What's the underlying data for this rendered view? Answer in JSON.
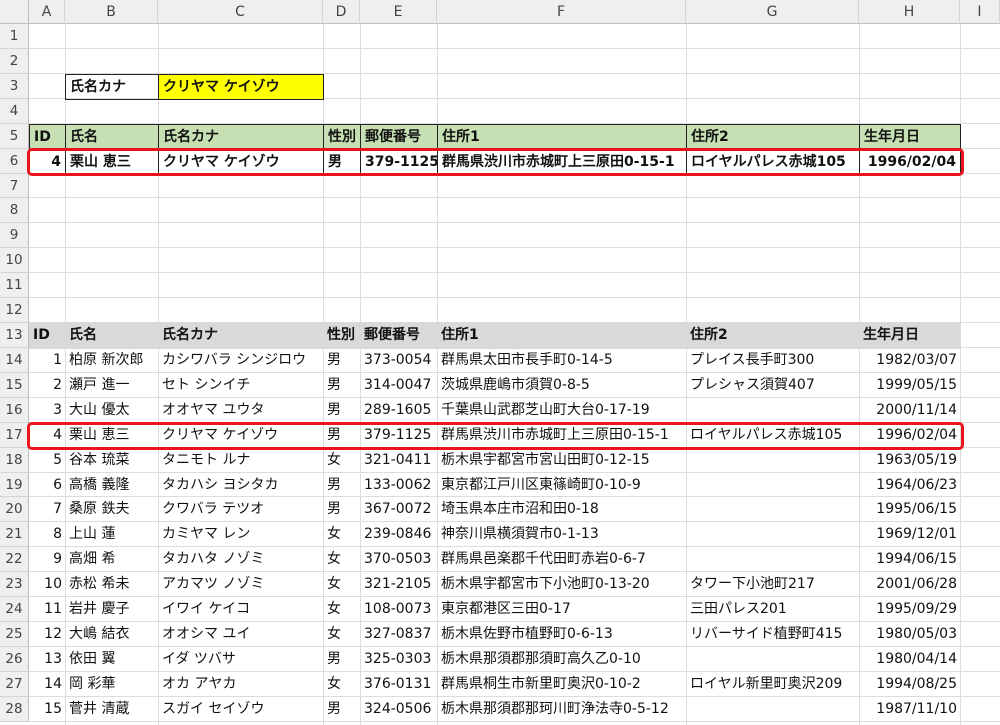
{
  "columns": [
    "A",
    "B",
    "C",
    "D",
    "E",
    "F",
    "G",
    "H",
    "I"
  ],
  "rows": [
    "1",
    "2",
    "3",
    "4",
    "5",
    "6",
    "7",
    "8",
    "9",
    "10",
    "11",
    "12",
    "13",
    "14",
    "15",
    "16",
    "17",
    "18",
    "19",
    "20",
    "21",
    "22",
    "23",
    "24",
    "25",
    "26",
    "27",
    "28"
  ],
  "search": {
    "label": "氏名カナ",
    "value": "クリヤマ ケイゾウ"
  },
  "result": {
    "headers": [
      "ID",
      "氏名",
      "氏名カナ",
      "性別",
      "郵便番号",
      "住所1",
      "住所2",
      "生年月日"
    ],
    "row": [
      "4",
      "栗山 恵三",
      "クリヤマ ケイゾウ",
      "男",
      "379-1125",
      "群馬県渋川市赤城町上三原田0-15-1",
      "ロイヤルパレス赤城105",
      "1996/02/04"
    ]
  },
  "table": {
    "headers": [
      "ID",
      "氏名",
      "氏名カナ",
      "性別",
      "郵便番号",
      "住所1",
      "住所2",
      "生年月日"
    ],
    "rows": [
      [
        "1",
        "柏原 新次郎",
        "カシワバラ シンジロウ",
        "男",
        "373-0054",
        "群馬県太田市長手町0-14-5",
        "プレイス長手町300",
        "1982/03/07"
      ],
      [
        "2",
        "瀬戸 進一",
        "セト シンイチ",
        "男",
        "314-0047",
        "茨城県鹿嶋市須賀0-8-5",
        "プレシャス須賀407",
        "1999/05/15"
      ],
      [
        "3",
        "大山 優太",
        "オオヤマ ユウタ",
        "男",
        "289-1605",
        "千葉県山武郡芝山町大台0-17-19",
        "",
        "2000/11/14"
      ],
      [
        "4",
        "栗山 恵三",
        "クリヤマ ケイゾウ",
        "男",
        "379-1125",
        "群馬県渋川市赤城町上三原田0-15-1",
        "ロイヤルパレス赤城105",
        "1996/02/04"
      ],
      [
        "5",
        "谷本 琉菜",
        "タニモト ルナ",
        "女",
        "321-0411",
        "栃木県宇都宮市宮山田町0-12-15",
        "",
        "1963/05/19"
      ],
      [
        "6",
        "高橋 義隆",
        "タカハシ ヨシタカ",
        "男",
        "133-0062",
        "東京都江戸川区東篠崎町0-10-9",
        "",
        "1964/06/23"
      ],
      [
        "7",
        "桑原 鉄夫",
        "クワバラ テツオ",
        "男",
        "367-0072",
        "埼玉県本庄市沼和田0-18",
        "",
        "1995/06/15"
      ],
      [
        "8",
        "上山 蓮",
        "カミヤマ レン",
        "女",
        "239-0846",
        "神奈川県横須賀市0-1-13",
        "",
        "1969/12/01"
      ],
      [
        "9",
        "高畑 希",
        "タカハタ ノゾミ",
        "女",
        "370-0503",
        "群馬県邑楽郡千代田町赤岩0-6-7",
        "",
        "1994/06/15"
      ],
      [
        "10",
        "赤松 希未",
        "アカマツ ノゾミ",
        "女",
        "321-2105",
        "栃木県宇都宮市下小池町0-13-20",
        "タワー下小池町217",
        "2001/06/28"
      ],
      [
        "11",
        "岩井 慶子",
        "イワイ ケイコ",
        "女",
        "108-0073",
        "東京都港区三田0-17",
        "三田パレス201",
        "1995/09/29"
      ],
      [
        "12",
        "大嶋 結衣",
        "オオシマ ユイ",
        "女",
        "327-0837",
        "栃木県佐野市植野町0-6-13",
        "リバーサイド植野町415",
        "1980/05/03"
      ],
      [
        "13",
        "依田 翼",
        "イダ ツバサ",
        "男",
        "325-0303",
        "栃木県那須郡那須町高久乙0-10",
        "",
        "1980/04/14"
      ],
      [
        "14",
        "岡 彩華",
        "オカ アヤカ",
        "女",
        "376-0131",
        "群馬県桐生市新里町奥沢0-10-2",
        "ロイヤル新里町奥沢209",
        "1994/08/25"
      ],
      [
        "15",
        "菅井 清蔵",
        "スガイ セイゾウ",
        "男",
        "324-0506",
        "栃木県那須郡那珂川町浄法寺0-5-12",
        "",
        "1987/11/10"
      ]
    ]
  },
  "colors": {
    "header_green": "#c6e0b4",
    "header_gray": "#d9d9d9",
    "search_yellow": "#ffff00",
    "highlight_red": "#e8141e"
  }
}
